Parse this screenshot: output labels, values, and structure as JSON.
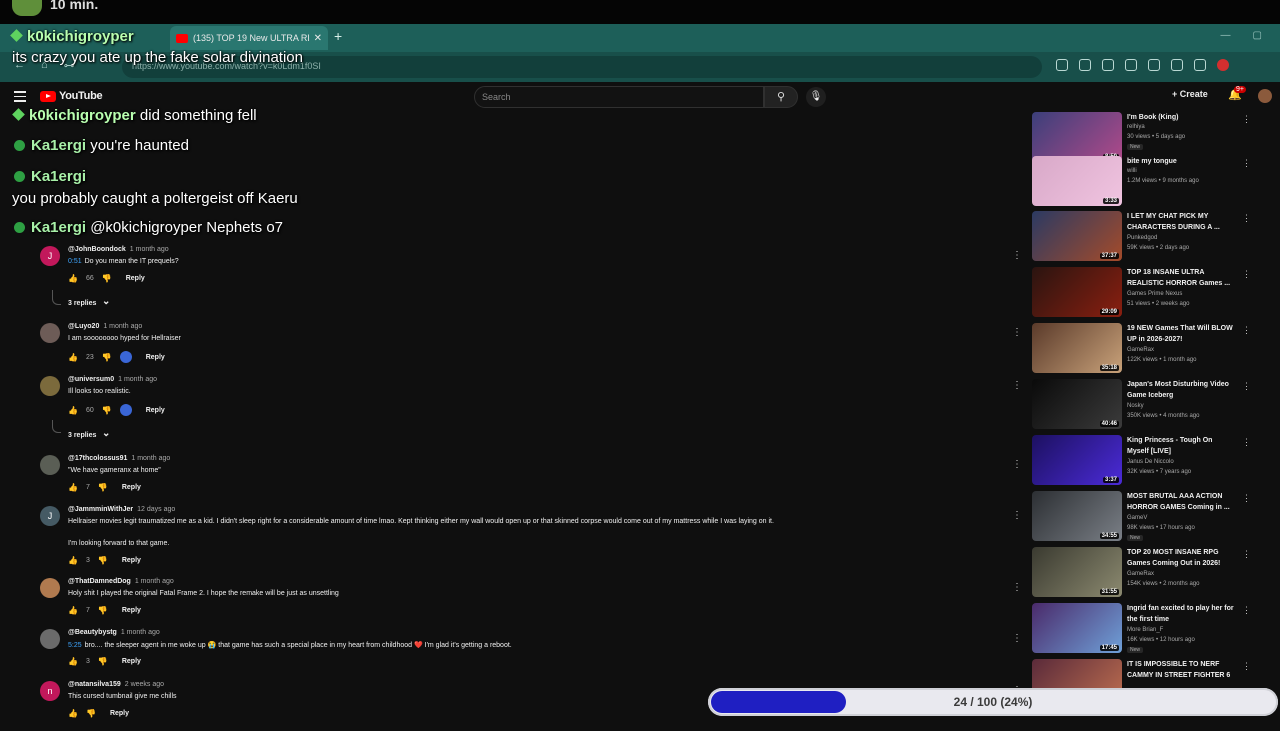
{
  "top_strip": {
    "text": "10 min."
  },
  "browser": {
    "tab_title": "(135) TOP 19 New ULTRA REALI",
    "new_tab": "+",
    "url": "https://www.youtube.com/watch?v=k0Ldm1f0SI"
  },
  "youtube": {
    "logo": "YouTube",
    "search_placeholder": "Search",
    "create": "+ Create",
    "notifications": "9+"
  },
  "chat": [
    {
      "user": "k0kichigroyper",
      "message": "its crazy you ate up the fake solar divination",
      "style": "diamond"
    },
    {
      "user": "k0kichigroyper",
      "message": "did something fell",
      "style": "diamond"
    },
    {
      "user": "Ka1ergi",
      "message": "you're haunted",
      "style": "badge"
    },
    {
      "user": "Ka1ergi",
      "message": "",
      "style": "badge"
    },
    {
      "user": "",
      "message": "you probably caught a poltergeist off Kaeru",
      "style": "none"
    },
    {
      "user": "Ka1ergi",
      "message": "@k0kichigroyper Nephets o7",
      "style": "badge"
    }
  ],
  "comments": [
    {
      "handle": "@JohnBoondock",
      "time": "1 month ago",
      "timestamp": "0:51",
      "text": "Do you mean the IT prequels?",
      "likes": "66",
      "avatar_letter": "J",
      "avatar_color": "#c2185b",
      "replies": "3 replies"
    },
    {
      "handle": "@Luyo20",
      "time": "1 month ago",
      "timestamp": "",
      "text": "I am soooooooo hyped for Hellraiser",
      "likes": "23",
      "avatar_letter": "",
      "avatar_color": "#6d5c57",
      "replies": ""
    },
    {
      "handle": "@universum0",
      "time": "1 month ago",
      "timestamp": "",
      "text": "Ill looks too realistic.",
      "likes": "60",
      "avatar_letter": "",
      "avatar_color": "#7b6a3c",
      "replies": "3 replies"
    },
    {
      "handle": "@17thcolossus91",
      "time": "1 month ago",
      "timestamp": "",
      "text": "\"We have gameranx at home\"",
      "likes": "7",
      "avatar_letter": "",
      "avatar_color": "#5a5e55",
      "replies": ""
    },
    {
      "handle": "@JammminWithJer",
      "time": "12 days ago",
      "timestamp": "",
      "text": "Hellraiser movies legit traumatized me as a kid. I didn't sleep right for a considerable amount of time lmao. Kept thinking either my wall would open up or that skinned corpse would come out of my mattress while I was laying on it.",
      "text2": "I'm looking forward to that game.",
      "likes": "3",
      "avatar_letter": "J",
      "avatar_color": "#455a64",
      "replies": ""
    },
    {
      "handle": "@ThatDamnedDog",
      "time": "1 month ago",
      "timestamp": "",
      "text": "Holy shit I played the original Fatal Frame 2. I hope the remake will be just as unsettling",
      "likes": "7",
      "avatar_letter": "",
      "avatar_color": "#b07a4f",
      "replies": ""
    },
    {
      "handle": "@Beautybystg",
      "time": "1 month ago",
      "timestamp": "5:25",
      "text": "bro.... the sleeper agent in me woke up 😭 that game has such a special place in my heart from childhood ❤️ I'm glad it's getting a reboot.",
      "likes": "3",
      "avatar_letter": "",
      "avatar_color": "#6b6b6b",
      "replies": ""
    },
    {
      "handle": "@natansilva159",
      "time": "2 weeks ago",
      "timestamp": "",
      "text": "This cursed tumbnail give me chills",
      "likes": "",
      "avatar_letter": "n",
      "avatar_color": "#c2185b",
      "replies": ""
    }
  ],
  "comment_ui": {
    "reply": "Reply"
  },
  "sidebar": [
    {
      "title": "I'm Book (King)",
      "channel": "relhiya",
      "meta": "30 views • 5 days ago",
      "badge": "New",
      "duration": "8:50",
      "color1": "#3b3f7a",
      "color2": "#b04a8a"
    },
    {
      "title": "bite my tongue",
      "channel": "willi",
      "meta": "1.2M views • 9 months ago",
      "badge": "",
      "duration": "3:33",
      "color1": "#d8a8c8",
      "color2": "#f0c4e0"
    },
    {
      "title": "I LET MY CHAT PICK MY CHARACTERS DURING A ...",
      "channel": "Punkedgod",
      "meta": "59K views • 2 days ago",
      "badge": "",
      "duration": "37:37",
      "color1": "#2b3a63",
      "color2": "#a44b2a"
    },
    {
      "title": "TOP 18 INSANE ULTRA REALISTIC HORROR Games ...",
      "channel": "Games Prime Nexus",
      "meta": "51 views • 2 weeks ago",
      "badge": "",
      "duration": "29:09",
      "color1": "#2a1410",
      "color2": "#8a1f10"
    },
    {
      "title": "19 NEW Games That Will BLOW UP in 2026-2027!",
      "channel": "GameRax",
      "meta": "122K views • 1 month ago",
      "badge": "",
      "duration": "35:18",
      "color1": "#5a3a2a",
      "color2": "#c9a27a"
    },
    {
      "title": "Japan's Most Disturbing Video Game Iceberg",
      "channel": "Nosky",
      "meta": "350K views • 4 months ago",
      "badge": "",
      "duration": "40:46",
      "color1": "#0a0a0a",
      "color2": "#3b3b3b"
    },
    {
      "title": "King Princess - Tough On Myself [LIVE]",
      "channel": "Janus De Niccolo",
      "meta": "32K views • 7 years ago",
      "badge": "",
      "duration": "3:37",
      "color1": "#1c1060",
      "color2": "#4b2bd8"
    },
    {
      "title": "MOST BRUTAL AAA ACTION HORROR GAMES Coming in ...",
      "channel": "GameV",
      "meta": "98K views • 17 hours ago",
      "badge": "New",
      "duration": "34:55",
      "color1": "#2c2f33",
      "color2": "#7a7f86"
    },
    {
      "title": "TOP 20 MOST INSANE RPG Games Coming Out in 2026!",
      "channel": "GameRax",
      "meta": "154K views • 2 months ago",
      "badge": "",
      "duration": "31:55",
      "color1": "#3a3a30",
      "color2": "#8c8a70"
    },
    {
      "title": "Ingrid fan excited to play her for the first time",
      "channel": "More Brian_F",
      "meta": "16K views • 12 hours ago",
      "badge": "New",
      "duration": "17:45",
      "color1": "#4a2a6a",
      "color2": "#6fa0d8"
    },
    {
      "title": "IT IS IMPOSSIBLE TO NERF CAMMY IN STREET FIGHTER 6",
      "channel": "",
      "meta": "",
      "badge": "",
      "duration": "",
      "color1": "#5a2a3a",
      "color2": "#c07050"
    }
  ],
  "progress": {
    "label": "24 / 100 (24%)",
    "fraction": 0.24
  }
}
